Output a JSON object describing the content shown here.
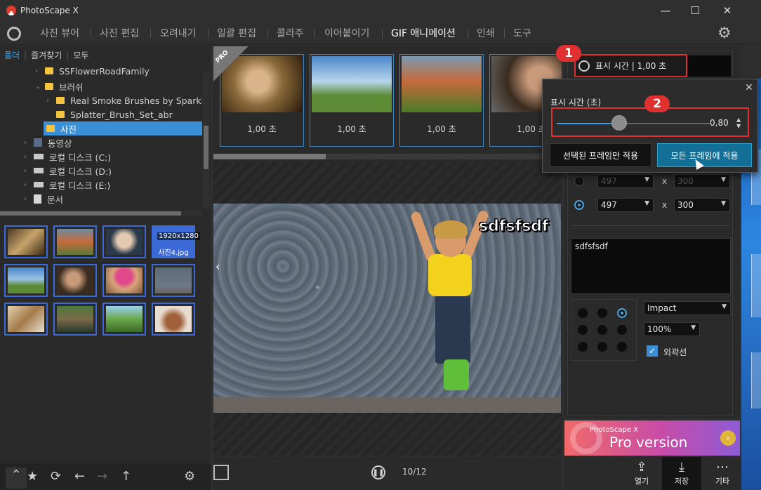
{
  "window": {
    "title": "PhotoScape X",
    "minimize": "—",
    "maximize": "☐",
    "close": "✕"
  },
  "menu": {
    "items": [
      "사진 뷰어",
      "사진 편집",
      "오려내기",
      "일괄 편집",
      "콜라주",
      "이어붙이기",
      "GIF 애니메이션",
      "인쇄",
      "도구"
    ],
    "active": "GIF 애니메이션"
  },
  "left": {
    "tabs": [
      "폴더",
      "즐겨찾기",
      "모두"
    ],
    "tree": [
      {
        "label": "SSFlowerRoadFamily"
      },
      {
        "label": "브러쉬"
      },
      {
        "label": "Real Smoke Brushes by Sparkle"
      },
      {
        "label": "Splatter_Brush_Set_abr"
      },
      {
        "label": "사진"
      },
      {
        "label": "동영상"
      },
      {
        "label": "로컬 디스크 (C:)"
      },
      {
        "label": "로컬 디스크 (D:)"
      },
      {
        "label": "로컬 디스크 (E:)"
      },
      {
        "label": "문서"
      }
    ],
    "selected_thumb": {
      "badge": "1920x1280",
      "name": "사진4.jpg"
    }
  },
  "frames": {
    "pro_label": "PRO",
    "times": [
      "1,00 초",
      "1,00 초",
      "1,00 초",
      "1,00 초"
    ]
  },
  "preview": {
    "caption": "sdfsfsdf",
    "counter": "10/12"
  },
  "right": {
    "display_time_button": "표시 시간 | 1,00 초",
    "size_x": "x",
    "size_a": {
      "w": "497",
      "h": "300"
    },
    "size_b": {
      "w": "497",
      "h": "300"
    },
    "text_value": "sdfsfsdf",
    "font": "Impact",
    "zoom": "100%",
    "outline_label": "외곽선",
    "pro_banner_small": "PhotoScape X",
    "pro_banner_big": "Pro version"
  },
  "popup": {
    "title": "표시 시간 (초)",
    "value": "0,80",
    "slider_fraction": 0.41,
    "apply_selected": "선택된 프레임만 적용",
    "apply_all": "모든 프레임에 적용",
    "close": "✕"
  },
  "markers": [
    "1",
    "2"
  ],
  "bottom": {
    "share": "열기",
    "save": "저장",
    "more": "기타"
  },
  "icons": [
    "settings-gear-icon",
    "refresh-icon",
    "star-icon",
    "arrow-left-icon",
    "arrow-right-icon",
    "arrow-up-icon",
    "pause-icon",
    "upload-icon",
    "download-icon",
    "more-icon",
    "clock-icon"
  ],
  "colors": {
    "accent": "#3a8fd6",
    "highlight": "#e03030",
    "primary_button": "#136f95"
  }
}
